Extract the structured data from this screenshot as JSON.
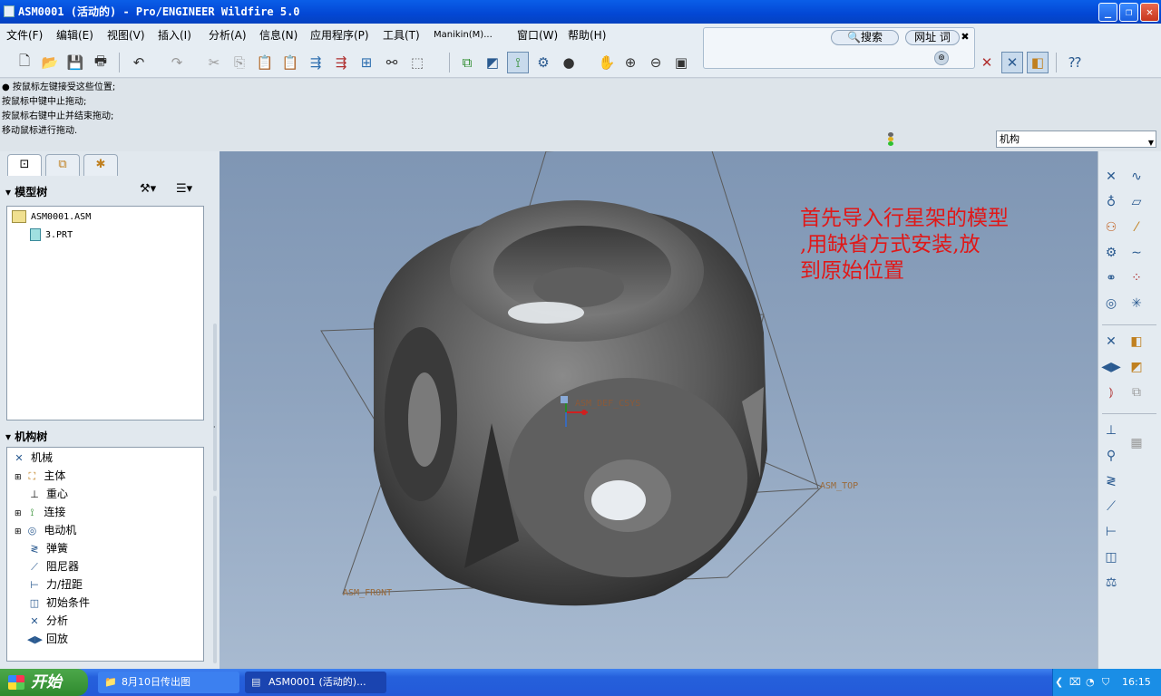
{
  "window": {
    "title": "ASM0001 (活动的) - Pro/ENGINEER Wildfire 5.0"
  },
  "menu": [
    "文件(F)",
    "编辑(E)",
    "视图(V)",
    "插入(I)",
    "分析(A)",
    "信息(N)",
    "应用程序(P)",
    "工具(T)",
    "Manikin(M)...",
    "窗口(W)",
    "帮助(H)"
  ],
  "search_toolbar": {
    "search_label": "搜索",
    "address_label": "网址 词"
  },
  "messages": [
    "● 按鼠标左键接受这些位置;",
    "按鼠标中键中止拖动;",
    "按鼠标右键中止并结束拖动;",
    "移动鼠标进行拖动."
  ],
  "filter": {
    "selected": "机构"
  },
  "model_tree": {
    "header": "模型树",
    "items": [
      "ASM0001.ASM",
      "3.PRT"
    ]
  },
  "mechanism_tree": {
    "header": "机构树",
    "items": [
      "机械",
      "主体",
      "重心",
      "连接",
      "电动机",
      "弹簧",
      "阻尼器",
      "力/扭距",
      "初始条件",
      "分析",
      "回放"
    ]
  },
  "viewport": {
    "annotation": [
      "首先导入行星架的模型",
      ",用缺省方式安装,放",
      "到原始位置"
    ],
    "datum_labels": {
      "csys": "ASM_DEF_CSYS",
      "top": "ASM_TOP",
      "front": "ASM_FRONT"
    }
  },
  "taskbar": {
    "start_label": "开始",
    "tasks": [
      "8月10日传出图",
      "ASM0001 (活动的)..."
    ],
    "clock": "16:15"
  },
  "colors": {
    "annotation": "#e01818",
    "titlebar": "#0a5ee8",
    "taskbar": "#245ad8",
    "start": "#3a9a38"
  }
}
